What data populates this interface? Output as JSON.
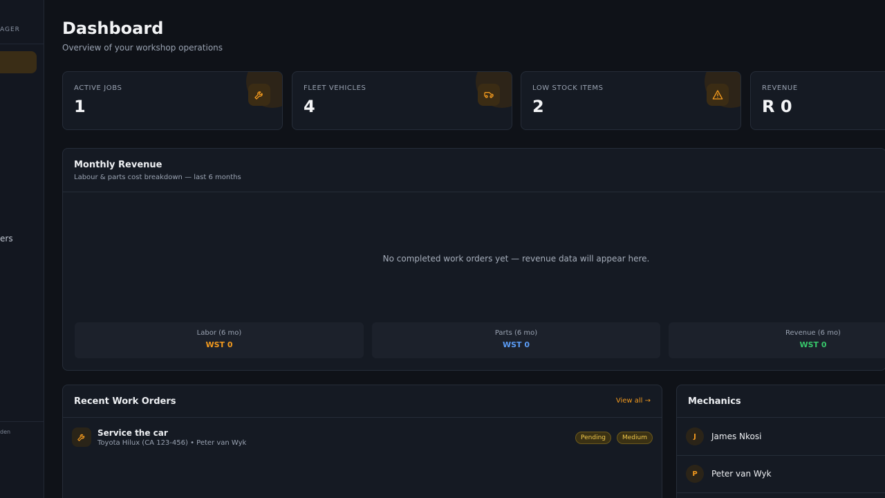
{
  "sidebar": {
    "brand_fragment": "AGER",
    "item_fragment": "ers",
    "footer_fragment": "den"
  },
  "header": {
    "title": "Dashboard",
    "subtitle": "Overview of your workshop operations"
  },
  "stats": [
    {
      "label": "ACTIVE JOBS",
      "value": "1",
      "icon": "wrench-icon"
    },
    {
      "label": "FLEET VEHICLES",
      "value": "4",
      "icon": "truck-icon"
    },
    {
      "label": "LOW STOCK ITEMS",
      "value": "2",
      "icon": "warning-icon"
    },
    {
      "label": "REVENUE",
      "value": "R 0",
      "icon": "revenue-icon"
    }
  ],
  "monthly_revenue": {
    "title": "Monthly Revenue",
    "subtitle": "Labour & parts cost breakdown — last 6 months",
    "empty_message": "No completed work orders yet — revenue data will appear here.",
    "summary": [
      {
        "label": "Labor (6 mo)",
        "value": "WST 0",
        "color": "#f39a1e"
      },
      {
        "label": "Parts (6 mo)",
        "value": "WST 0",
        "color": "#5b9cf5"
      },
      {
        "label": "Revenue (6 mo)",
        "value": "WST 0",
        "color": "#37c76b"
      }
    ]
  },
  "recent_work_orders": {
    "title": "Recent Work Orders",
    "view_all": "View all →",
    "items": [
      {
        "title": "Service the car",
        "meta": "Toyota Hilux (CA 123-456) • Peter van Wyk",
        "status": "Pending",
        "priority": "Medium"
      }
    ]
  },
  "mechanics": {
    "title": "Mechanics",
    "items": [
      {
        "initial": "J",
        "name": "James Nkosi"
      },
      {
        "initial": "P",
        "name": "Peter van Wyk"
      }
    ]
  },
  "colors": {
    "accent": "#f39a1e",
    "background": "#0f1218",
    "card": "#151a23"
  }
}
